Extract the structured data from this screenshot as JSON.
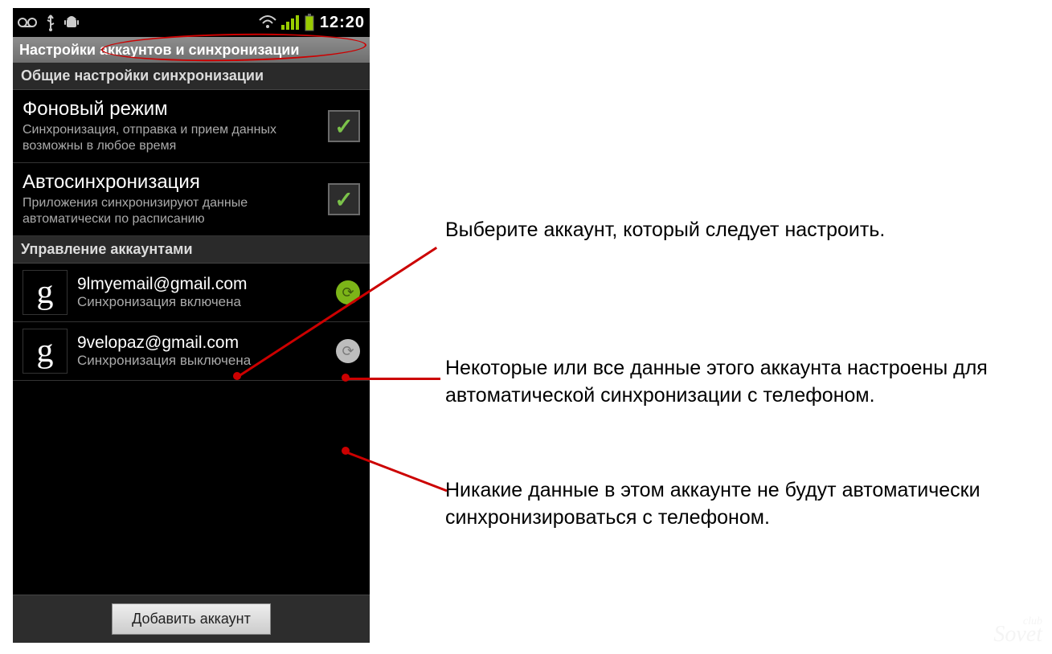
{
  "statusbar": {
    "time": "12:20"
  },
  "title": "Настройки аккаунтов и синхронизации",
  "sections": {
    "general": "Общие настройки синхронизации",
    "accounts": "Управление аккаунтами"
  },
  "settings": {
    "background": {
      "title": "Фоновый режим",
      "sub": "Синхронизация, отправка и прием данных возможны в любое время",
      "checked": true
    },
    "autosync": {
      "title": "Автосинхронизация",
      "sub": "Приложения синхронизируют данные автоматически по расписанию",
      "checked": true
    }
  },
  "accounts": [
    {
      "provider": "g",
      "email": "9lmyemail@gmail.com",
      "status": "Синхронизация включена",
      "sync_on": true
    },
    {
      "provider": "g",
      "email": "9velopaz@gmail.com",
      "status": "Синхронизация выключена",
      "sync_on": false
    }
  ],
  "buttons": {
    "add_account": "Добавить аккаунт"
  },
  "annotations": {
    "a1": "Выберите аккаунт, который следует настроить.",
    "a2": "Некоторые или все данные этого аккаунта настроены для автоматической синхронизации с телефоном.",
    "a3": "Никакие данные в этом аккаунте не будут автоматически синхронизироваться с телефоном."
  },
  "watermark": {
    "top": "club",
    "main": "Sovet"
  }
}
